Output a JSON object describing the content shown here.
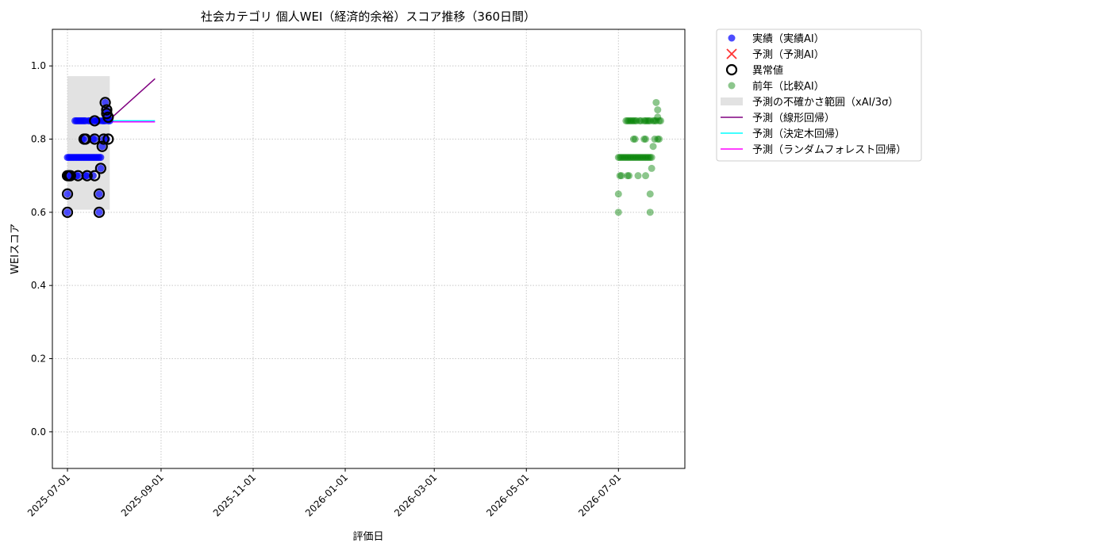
{
  "chart_data": {
    "type": "scatter",
    "title": "社会カテゴリ 個人WEI（経済的余裕）スコア推移（360日間）",
    "xlabel": "評価日",
    "ylabel": "WEIスコア",
    "xlim": [
      "2025-06-21",
      "2026-08-14"
    ],
    "ylim": [
      -0.1,
      1.1
    ],
    "grid": true,
    "legend_placement": "outside upper-right",
    "x_ticks": [
      "2025-07-01",
      "2025-09-01",
      "2025-11-01",
      "2026-01-01",
      "2026-03-01",
      "2026-05-01",
      "2026-07-01"
    ],
    "y_ticks": [
      "0.0",
      "0.2",
      "0.4",
      "0.6",
      "0.8",
      "1.0"
    ],
    "uncertainty_band": {
      "x": [
        "2025-07-01",
        "2025-07-29"
      ],
      "y": [
        0.607,
        0.972
      ]
    },
    "legend": [
      {
        "label": "実績（実績AI）",
        "marker": "dot",
        "color": "#0000ff"
      },
      {
        "label": "予測（予測AI）",
        "marker": "x",
        "color": "#ff0000"
      },
      {
        "label": "異常値",
        "marker": "ring",
        "color": "#000000"
      },
      {
        "label": "前年（比較AI）",
        "marker": "dot",
        "color": "#008000"
      },
      {
        "label": "予測の不確かさ範囲（xAI/3σ）",
        "marker": "band",
        "color": "#d3d3d3"
      },
      {
        "label": "予測（線形回帰）",
        "marker": "line",
        "color": "#800080"
      },
      {
        "label": "予測（決定木回帰）",
        "marker": "line",
        "color": "#00ffff"
      },
      {
        "label": "予測（ランダムフォレスト回帰）",
        "marker": "line",
        "color": "#ff00ff"
      }
    ],
    "series": [
      {
        "name": "実績（実績AI）",
        "kind": "scatter",
        "color": "#0000ff",
        "points": [
          [
            "2025-07-01",
            0.75
          ],
          [
            "2025-07-02",
            0.75
          ],
          [
            "2025-07-03",
            0.75
          ],
          [
            "2025-07-04",
            0.75
          ],
          [
            "2025-07-05",
            0.75
          ],
          [
            "2025-07-06",
            0.75
          ],
          [
            "2025-07-07",
            0.75
          ],
          [
            "2025-07-08",
            0.75
          ],
          [
            "2025-07-09",
            0.75
          ],
          [
            "2025-07-10",
            0.75
          ],
          [
            "2025-07-11",
            0.75
          ],
          [
            "2025-07-12",
            0.75
          ],
          [
            "2025-07-13",
            0.75
          ],
          [
            "2025-07-14",
            0.75
          ],
          [
            "2025-07-15",
            0.75
          ],
          [
            "2025-07-16",
            0.75
          ],
          [
            "2025-07-17",
            0.75
          ],
          [
            "2025-07-18",
            0.75
          ],
          [
            "2025-07-19",
            0.75
          ],
          [
            "2025-07-20",
            0.75
          ],
          [
            "2025-07-21",
            0.75
          ],
          [
            "2025-07-22",
            0.75
          ],
          [
            "2025-07-23",
            0.75
          ],
          [
            "2025-07-06",
            0.85
          ],
          [
            "2025-07-07",
            0.85
          ],
          [
            "2025-07-08",
            0.85
          ],
          [
            "2025-07-09",
            0.85
          ],
          [
            "2025-07-10",
            0.85
          ],
          [
            "2025-07-11",
            0.85
          ],
          [
            "2025-07-12",
            0.85
          ],
          [
            "2025-07-13",
            0.85
          ],
          [
            "2025-07-15",
            0.85
          ],
          [
            "2025-07-16",
            0.85
          ],
          [
            "2025-07-18",
            0.85
          ],
          [
            "2025-07-19",
            0.85
          ],
          [
            "2025-07-20",
            0.85
          ],
          [
            "2025-07-21",
            0.85
          ],
          [
            "2025-07-22",
            0.85
          ],
          [
            "2025-07-24",
            0.85
          ],
          [
            "2025-07-25",
            0.85
          ],
          [
            "2025-07-26",
            0.85
          ],
          [
            "2025-07-28",
            0.85
          ],
          [
            "2025-07-29",
            0.85
          ],
          [
            "2025-07-02",
            0.7
          ],
          [
            "2025-07-03",
            0.7
          ],
          [
            "2025-07-07",
            0.7
          ],
          [
            "2025-07-08",
            0.7
          ],
          [
            "2025-07-13",
            0.7
          ],
          [
            "2025-07-14",
            0.7
          ],
          [
            "2025-07-18",
            0.7
          ],
          [
            "2025-07-11",
            0.8
          ],
          [
            "2025-07-12",
            0.8
          ],
          [
            "2025-07-18",
            0.8
          ],
          [
            "2025-07-19",
            0.8
          ],
          [
            "2025-07-25",
            0.8
          ],
          [
            "2025-07-27",
            0.8
          ],
          [
            "2025-07-01",
            0.65
          ],
          [
            "2025-07-01",
            0.6
          ],
          [
            "2025-07-22",
            0.65
          ],
          [
            "2025-07-22",
            0.6
          ],
          [
            "2025-07-23",
            0.72
          ],
          [
            "2025-07-24",
            0.78
          ],
          [
            "2025-07-26",
            0.9
          ],
          [
            "2025-07-27",
            0.88
          ],
          [
            "2025-07-27",
            0.87
          ],
          [
            "2025-07-28",
            0.86
          ]
        ]
      },
      {
        "name": "異常値",
        "kind": "outlier",
        "color": "#000000",
        "points": [
          [
            "2025-07-01",
            0.7
          ],
          [
            "2025-07-02",
            0.7
          ],
          [
            "2025-07-03",
            0.7
          ],
          [
            "2025-07-08",
            0.7
          ],
          [
            "2025-07-14",
            0.7
          ],
          [
            "2025-07-19",
            0.7
          ],
          [
            "2025-07-01",
            0.65
          ],
          [
            "2025-07-01",
            0.6
          ],
          [
            "2025-07-22",
            0.65
          ],
          [
            "2025-07-22",
            0.6
          ],
          [
            "2025-07-23",
            0.72
          ],
          [
            "2025-07-24",
            0.78
          ],
          [
            "2025-07-12",
            0.8
          ],
          [
            "2025-07-13",
            0.8
          ],
          [
            "2025-07-19",
            0.8
          ],
          [
            "2025-07-25",
            0.8
          ],
          [
            "2025-07-28",
            0.8
          ],
          [
            "2025-07-19",
            0.85
          ],
          [
            "2025-07-26",
            0.9
          ],
          [
            "2025-07-27",
            0.88
          ],
          [
            "2025-07-27",
            0.87
          ],
          [
            "2025-07-28",
            0.86
          ]
        ]
      },
      {
        "name": "前年（比較AI）",
        "kind": "scatter",
        "color": "#008000",
        "points": [
          [
            "2026-07-01",
            0.75
          ],
          [
            "2026-07-02",
            0.75
          ],
          [
            "2026-07-03",
            0.75
          ],
          [
            "2026-07-04",
            0.75
          ],
          [
            "2026-07-05",
            0.75
          ],
          [
            "2026-07-06",
            0.75
          ],
          [
            "2026-07-07",
            0.75
          ],
          [
            "2026-07-08",
            0.75
          ],
          [
            "2026-07-09",
            0.75
          ],
          [
            "2026-07-10",
            0.75
          ],
          [
            "2026-07-11",
            0.75
          ],
          [
            "2026-07-12",
            0.75
          ],
          [
            "2026-07-13",
            0.75
          ],
          [
            "2026-07-14",
            0.75
          ],
          [
            "2026-07-15",
            0.75
          ],
          [
            "2026-07-16",
            0.75
          ],
          [
            "2026-07-17",
            0.75
          ],
          [
            "2026-07-18",
            0.75
          ],
          [
            "2026-07-19",
            0.75
          ],
          [
            "2026-07-20",
            0.75
          ],
          [
            "2026-07-21",
            0.75
          ],
          [
            "2026-07-22",
            0.75
          ],
          [
            "2026-07-23",
            0.75
          ],
          [
            "2026-07-06",
            0.85
          ],
          [
            "2026-07-07",
            0.85
          ],
          [
            "2026-07-08",
            0.85
          ],
          [
            "2026-07-09",
            0.85
          ],
          [
            "2026-07-10",
            0.85
          ],
          [
            "2026-07-11",
            0.85
          ],
          [
            "2026-07-12",
            0.85
          ],
          [
            "2026-07-13",
            0.85
          ],
          [
            "2026-07-15",
            0.85
          ],
          [
            "2026-07-16",
            0.85
          ],
          [
            "2026-07-18",
            0.85
          ],
          [
            "2026-07-19",
            0.85
          ],
          [
            "2026-07-20",
            0.85
          ],
          [
            "2026-07-21",
            0.85
          ],
          [
            "2026-07-22",
            0.85
          ],
          [
            "2026-07-24",
            0.85
          ],
          [
            "2026-07-25",
            0.85
          ],
          [
            "2026-07-26",
            0.85
          ],
          [
            "2026-07-28",
            0.85
          ],
          [
            "2026-07-29",
            0.85
          ],
          [
            "2026-07-02",
            0.7
          ],
          [
            "2026-07-03",
            0.7
          ],
          [
            "2026-07-07",
            0.7
          ],
          [
            "2026-07-08",
            0.7
          ],
          [
            "2026-07-14",
            0.7
          ],
          [
            "2026-07-19",
            0.7
          ],
          [
            "2026-07-11",
            0.8
          ],
          [
            "2026-07-12",
            0.8
          ],
          [
            "2026-07-18",
            0.8
          ],
          [
            "2026-07-19",
            0.8
          ],
          [
            "2026-07-25",
            0.8
          ],
          [
            "2026-07-27",
            0.8
          ],
          [
            "2026-07-28",
            0.8
          ],
          [
            "2026-07-01",
            0.65
          ],
          [
            "2026-07-01",
            0.6
          ],
          [
            "2026-07-22",
            0.65
          ],
          [
            "2026-07-22",
            0.6
          ],
          [
            "2026-07-23",
            0.72
          ],
          [
            "2026-07-24",
            0.78
          ],
          [
            "2026-07-26",
            0.9
          ],
          [
            "2026-07-27",
            0.88
          ],
          [
            "2026-07-27",
            0.86
          ]
        ]
      },
      {
        "name": "予測（線形回帰）",
        "kind": "line",
        "color": "#800080",
        "points": [
          [
            "2025-07-28",
            0.85
          ],
          [
            "2025-08-28",
            0.965
          ]
        ]
      },
      {
        "name": "予測（決定木回帰）",
        "kind": "line",
        "color": "#00ffff",
        "points": [
          [
            "2025-07-28",
            0.85
          ],
          [
            "2025-08-28",
            0.85
          ]
        ]
      },
      {
        "name": "予測（ランダムフォレスト回帰）",
        "kind": "line",
        "color": "#ff00ff",
        "points": [
          [
            "2025-07-28",
            0.847
          ],
          [
            "2025-08-28",
            0.847
          ]
        ]
      }
    ]
  }
}
